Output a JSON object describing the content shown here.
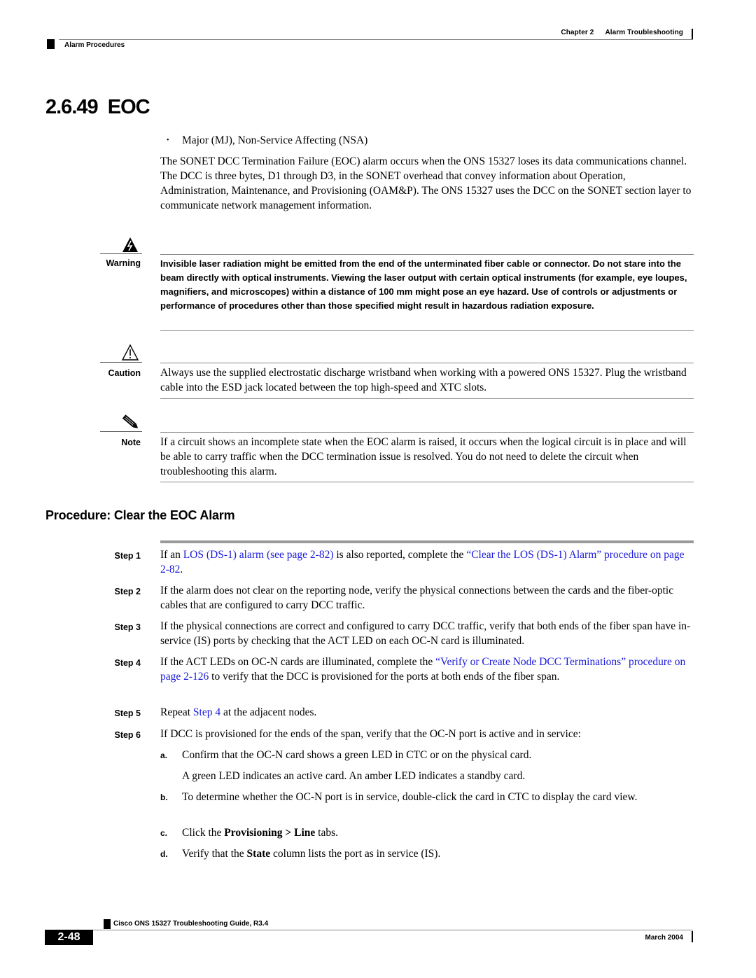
{
  "header": {
    "chapter": "Chapter 2",
    "chapter_title": "Alarm Troubleshooting",
    "section": "Alarm Procedures"
  },
  "title": "2.6.49  EOC",
  "severity_bullet": "Major (MJ), Non-Service Affecting (NSA)",
  "description": "The SONET DCC Termination Failure (EOC) alarm occurs when the ONS 15327 loses its data communications channel. The DCC is three bytes, D1 through D3, in the SONET overhead that convey information about Operation, Administration, Maintenance, and Provisioning (OAM&P). The ONS 15327 uses the DCC on the SONET section layer to communicate network management information.",
  "warning": {
    "label": "Warning",
    "icon": "warning-lightning-triangle-icon",
    "text": "Invisible laser radiation might be emitted from the end of the unterminated fiber cable or connector. Do not stare into the beam directly with optical instruments. Viewing the laser output with certain optical instruments (for example, eye loupes, magnifiers, and microscopes) within a distance of 100 mm might pose an eye hazard. Use of controls or adjustments or performance of procedures other than those specified might result in hazardous radiation exposure."
  },
  "caution": {
    "label": "Caution",
    "icon": "caution-triangle-icon",
    "text": "Always use the supplied electrostatic discharge wristband when working with a powered ONS 15327. Plug the wristband cable into the ESD jack located between the top high-speed and XTC slots."
  },
  "note": {
    "label": "Note",
    "icon": "pencil-icon",
    "text": "If a circuit shows an incomplete state when the EOC alarm is raised, it occurs when the logical circuit is in place and will be able to carry traffic when the DCC termination issue is resolved. You do not need to delete the circuit when troubleshooting this alarm."
  },
  "procedure": {
    "title": "Procedure: Clear the EOC Alarm",
    "link_color": "#1a1adb",
    "steps": [
      {
        "label": "Step 1",
        "pre": "If an ",
        "link1": "LOS (DS-1) alarm (see page 2-82)",
        "mid": " is also reported, complete the ",
        "link2": "“Clear the LOS (DS-1) Alarm” procedure on page 2-82",
        "post": "."
      },
      {
        "label": "Step 2",
        "text": "If the alarm does not clear on the reporting node, verify the physical connections between the cards and the fiber-optic cables that are configured to carry DCC traffic."
      },
      {
        "label": "Step 3",
        "text": "If the physical connections are correct and configured to carry DCC traffic, verify that both ends of the fiber span have in-service (IS) ports by checking that the ACT LED on each OC-N card is illuminated."
      },
      {
        "label": "Step 4",
        "pre": "If the ACT LEDs on OC-N cards are illuminated, complete the ",
        "link1": "“Verify or Create Node DCC Terminations” procedure on page 2-126",
        "post": " to verify that the DCC is provisioned for the ports at both ends of the fiber span."
      },
      {
        "label": "Step 5",
        "pre": "Repeat ",
        "link1": "Step 4",
        "post": " at the adjacent nodes."
      },
      {
        "label": "Step 6",
        "text": "If DCC is provisioned for the ends of the span, verify that the OC-N port is active and in service:",
        "substeps": [
          {
            "label": "a.",
            "text": "Confirm that the OC-N card shows a green LED in CTC or on the physical card.",
            "extra": "A green LED indicates an active card. An amber LED indicates a standby card."
          },
          {
            "label": "b.",
            "text": "To determine whether the OC-N port is in service, double-click the card in CTC to display the card view."
          },
          {
            "label": "c.",
            "pre": "Click the ",
            "bold": "Provisioning > Line",
            "post": " tabs."
          },
          {
            "label": "d.",
            "pre": "Verify that the ",
            "bold": "State",
            "post": " column lists the port as in service (IS)."
          }
        ]
      }
    ]
  },
  "footer": {
    "guide_title": "Cisco ONS 15327 Troubleshooting Guide, R3.4",
    "page_number": "2-48",
    "date": "March 2004"
  }
}
